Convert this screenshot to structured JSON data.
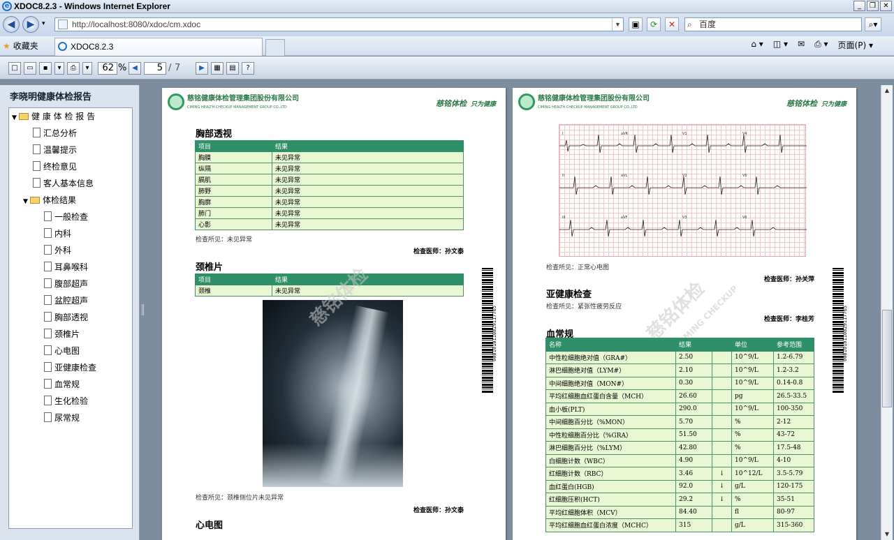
{
  "window": {
    "title": "XDOC8.2.3 - Windows Internet Explorer"
  },
  "address": {
    "url": "http://localhost:8080/xdoc/cm.xdoc",
    "search_placeholder": "百度"
  },
  "tabs": {
    "favorites": "收藏夹",
    "active": "XDOC8.2.3",
    "page_menu": "页面(P)"
  },
  "toolbar": {
    "zoom": "62",
    "zoom_unit": "%",
    "page": "5",
    "page_sep": "/",
    "page_total": "7"
  },
  "sidebar": {
    "title": "李晓明健康体检报告",
    "root": "健 康 体 检 报 告",
    "items": [
      "汇总分析",
      "温馨提示",
      "终检意见",
      "客人基本信息"
    ],
    "results": "体检结果",
    "sub": [
      "一般检查",
      "内科",
      "外科",
      "耳鼻喉科",
      "腹部超声",
      "盆腔超声",
      "胸部透视",
      "颈椎片",
      "心电图",
      "亚健康检查",
      "血常规",
      "生化检验",
      "尿常规"
    ]
  },
  "brand": {
    "cn": "慈铭健康体检管理集团股份有限公司",
    "en": "CIMING HEALTH CHECKUP MANAGEMENT GROUP CO.,LTD",
    "slogan1": "慈铭体检",
    "slogan2": "只为健康",
    "wm": "慈铭体检",
    "wm_en": "CIMING CHECKUP"
  },
  "page_left": {
    "chest": {
      "title": "胸部透视",
      "headers": [
        "项目",
        "结果"
      ],
      "rows": [
        [
          "胸膜",
          "未见异常"
        ],
        [
          "纵隔",
          "未见异常"
        ],
        [
          "膈肌",
          "未见异常"
        ],
        [
          "肺野",
          "未见异常"
        ],
        [
          "胸廓",
          "未见异常"
        ],
        [
          "肺门",
          "未见异常"
        ],
        [
          "心影",
          "未见异常"
        ]
      ],
      "finding": "检查所见：未见异常",
      "doctor": "检查医师：孙文泰"
    },
    "neck": {
      "title": "颈椎片",
      "headers": [
        "项目",
        "结果"
      ],
      "rows": [
        [
          "颈椎",
          "未见异常"
        ]
      ],
      "finding": "检查所见：颈椎侧位片未见异常",
      "doctor": "检查医师：孙文泰"
    },
    "ecg_title": "心电图",
    "barcode": "0001010110829117765"
  },
  "page_right": {
    "ecg": {
      "leads": [
        "I",
        "aVR",
        "V1",
        "V4",
        "II",
        "aVL",
        "V2",
        "V5",
        "III",
        "aVF",
        "V3",
        "V6"
      ],
      "finding": "检查所见：正常心电图",
      "doctor": "检查医师：孙关萍"
    },
    "sub": {
      "title": "亚健康检查",
      "finding": "检查所见：紧张性疲劳反应",
      "doctor": "检查医师：李桂芳"
    },
    "blood": {
      "title": "血常规",
      "headers": [
        "名称",
        "结果",
        "",
        "单位",
        "参考范围"
      ],
      "rows": [
        [
          "中性粒细胞绝对值（GRA#）",
          "2.50",
          "",
          "10^9/L",
          "1.2-6.79"
        ],
        [
          "淋巴细胞绝对值（LYM#）",
          "2.10",
          "",
          "10^9/L",
          "1.2-3.2"
        ],
        [
          "中间细胞绝对值（MON#）",
          "0.30",
          "",
          "10^9/L",
          "0.14-0.8"
        ],
        [
          "平均红细胞血红蛋白含量（MCH）",
          "26.60",
          "",
          "pg",
          "26.5-33.5"
        ],
        [
          "血小板(PLT)",
          "290.0",
          "",
          "10^9/L",
          "100-350"
        ],
        [
          "中间细胞百分比（%MON）",
          "5.70",
          "",
          "%",
          "2-12"
        ],
        [
          "中性粒细胞百分比（%GRA）",
          "51.50",
          "",
          "%",
          "43-72"
        ],
        [
          "淋巴细胞百分比（%LYM）",
          "42.80",
          "",
          "%",
          "17.5-48"
        ],
        [
          "白细胞计数（WBC）",
          "4.90",
          "",
          "10^9/L",
          "4-10"
        ],
        [
          "红细胞计数（RBC）",
          "3.46",
          "↓",
          "10^12/L",
          "3.5-5.79"
        ],
        [
          "血红蛋白(HGB)",
          "92.0",
          "↓",
          "g/L",
          "120-175"
        ],
        [
          "红细胞压积(HCT)",
          "29.2",
          "↓",
          "%",
          "35-51"
        ],
        [
          "平均红细胞体积（MCV）",
          "84.40",
          "",
          "fl",
          "80-97"
        ],
        [
          "平均红细胞血红蛋白浓度（MCHC）",
          "315",
          "",
          "g/L",
          "315-360"
        ]
      ]
    },
    "barcode": "0001010110829117765"
  }
}
